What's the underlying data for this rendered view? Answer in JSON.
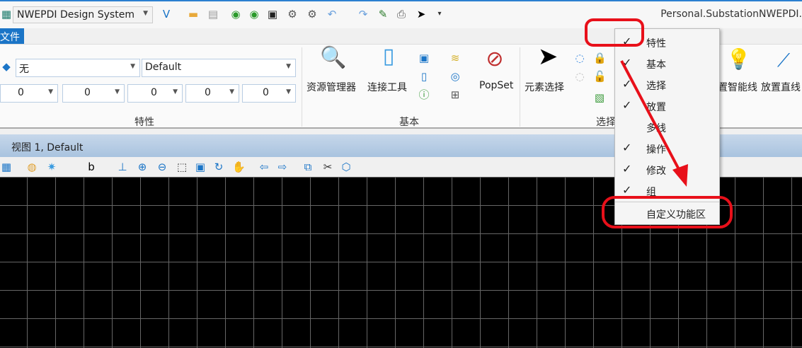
{
  "titlebar": {
    "workspace": "NWEPDI Design System",
    "window_title": "Personal.SubstationNWEPDI."
  },
  "menu": {
    "file_tab": "文件"
  },
  "ribbon": {
    "properties": {
      "level": "无",
      "style": "Default",
      "color": "0",
      "weight": "0",
      "linestyle": "0",
      "transparency": "0",
      "priority": "0",
      "group_label": "特性"
    },
    "basic": {
      "explorer": "资源管理器",
      "attach_tools": "连接工具",
      "popset": "PopSet",
      "group_label": "基本"
    },
    "selection": {
      "element_select": "元素选择",
      "group_label": "选择"
    },
    "placement": {
      "smartline": "置智能线",
      "place_line": "放置直线"
    }
  },
  "view": {
    "title": "视图 1, Default"
  },
  "context_menu": {
    "items": [
      {
        "label": "特性",
        "checked": "✓"
      },
      {
        "label": "基本",
        "checked": "✓"
      },
      {
        "label": "选择",
        "checked": "✓"
      },
      {
        "label": "放置",
        "checked": "✓"
      },
      {
        "label": "多线",
        "checked": ""
      },
      {
        "label": "操作",
        "checked": "✓"
      },
      {
        "label": "修改",
        "checked": "✓"
      },
      {
        "label": "组",
        "checked": "✓"
      }
    ],
    "customize": "自定义功能区"
  },
  "colors": {
    "accent": "#1b75c7",
    "annotation": "#e8101a"
  }
}
